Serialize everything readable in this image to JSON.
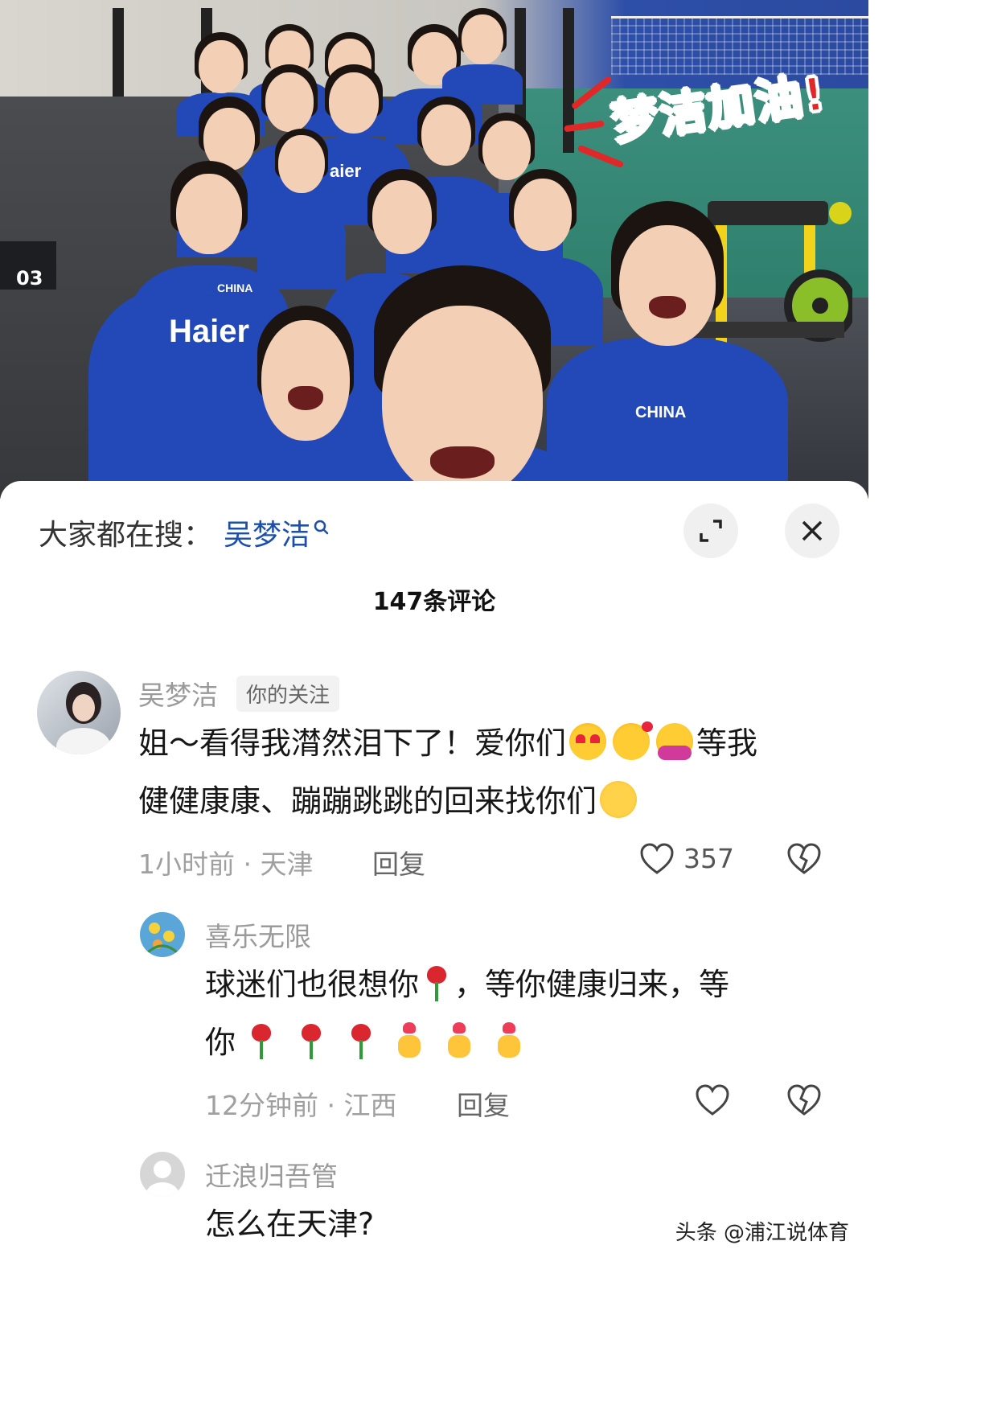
{
  "video": {
    "sticker_text": "梦洁加油!",
    "shirt_brand": "Haier",
    "shirt_team": "CHINA",
    "box_number": "03"
  },
  "sheet": {
    "search_prefix": "大家都在搜：",
    "search_term": "吴梦洁",
    "comment_count": "147条评论"
  },
  "comments": [
    {
      "name": "吴梦洁",
      "tag": "你的关注",
      "line1": "姐～看得我潸然泪下了！爱你们",
      "line1_tail": "等我",
      "line2": "健健康康、蹦蹦跳跳的回来找你们",
      "time": "1小时前 · 天津",
      "reply": "回复",
      "likes": "357"
    },
    {
      "name": "喜乐无限",
      "line1": "球迷们也很想你",
      "line1_tail": "，等你健康归来，等",
      "line2": "你",
      "time": "12分钟前 · 江西",
      "reply": "回复"
    },
    {
      "name": "迁浪归吾管",
      "line1": "怎么在天津?"
    }
  ],
  "watermark": "头条 @浦江说体育",
  "colors": {
    "link": "#1e4fa8",
    "shirt": "#2348b8",
    "sticker": "#e02828"
  }
}
